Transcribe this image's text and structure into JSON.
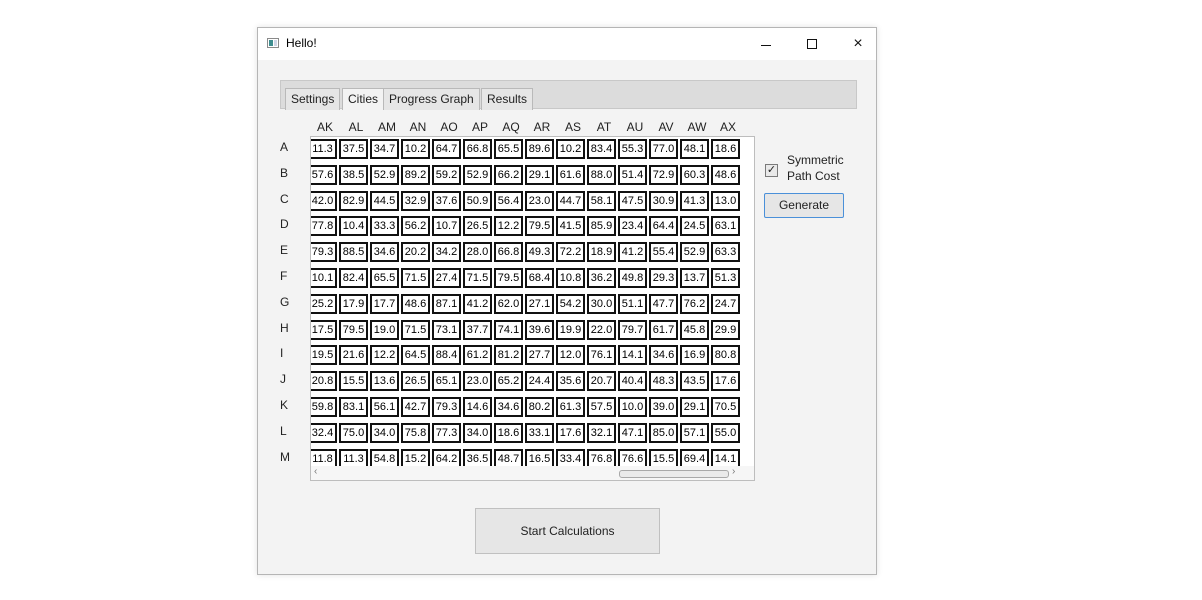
{
  "window": {
    "title": "Hello!",
    "controls": {
      "minimize": "minimize",
      "maximize": "maximize",
      "close": "×"
    }
  },
  "tabs": [
    {
      "label": "Settings",
      "active": false
    },
    {
      "label": "Cities",
      "active": true
    },
    {
      "label": "Progress Graph",
      "active": false
    },
    {
      "label": "Results",
      "active": false
    }
  ],
  "matrix": {
    "columns": [
      "AK",
      "AL",
      "AM",
      "AN",
      "AO",
      "AP",
      "AQ",
      "AR",
      "AS",
      "AT",
      "AU",
      "AV",
      "AW",
      "AX"
    ],
    "rows": [
      "A",
      "B",
      "C",
      "D",
      "E",
      "F",
      "G",
      "H",
      "I",
      "J",
      "K",
      "L",
      "M"
    ],
    "values": [
      [
        "11.3",
        "37.5",
        "34.7",
        "10.2",
        "64.7",
        "66.8",
        "65.5",
        "89.6",
        "10.2",
        "83.4",
        "55.3",
        "77.0",
        "48.1",
        "18.6"
      ],
      [
        "57.6",
        "38.5",
        "52.9",
        "89.2",
        "59.2",
        "52.9",
        "66.2",
        "29.1",
        "61.6",
        "88.0",
        "51.4",
        "72.9",
        "60.3",
        "48.6"
      ],
      [
        "42.0",
        "82.9",
        "44.5",
        "32.9",
        "37.6",
        "50.9",
        "56.4",
        "23.0",
        "44.7",
        "58.1",
        "47.5",
        "30.9",
        "41.3",
        "13.0"
      ],
      [
        "77.8",
        "10.4",
        "33.3",
        "56.2",
        "10.7",
        "26.5",
        "12.2",
        "79.5",
        "41.5",
        "85.9",
        "23.4",
        "64.4",
        "24.5",
        "63.1"
      ],
      [
        "79.3",
        "88.5",
        "34.6",
        "20.2",
        "34.2",
        "28.0",
        "66.8",
        "49.3",
        "72.2",
        "18.9",
        "41.2",
        "55.4",
        "52.9",
        "63.3"
      ],
      [
        "10.1",
        "82.4",
        "65.5",
        "71.5",
        "27.4",
        "71.5",
        "79.5",
        "68.4",
        "10.8",
        "36.2",
        "49.8",
        "29.3",
        "13.7",
        "51.3"
      ],
      [
        "25.2",
        "17.9",
        "17.7",
        "48.6",
        "87.1",
        "41.2",
        "62.0",
        "27.1",
        "54.2",
        "30.0",
        "51.1",
        "47.7",
        "76.2",
        "24.7"
      ],
      [
        "17.5",
        "79.5",
        "19.0",
        "71.5",
        "73.1",
        "37.7",
        "74.1",
        "39.6",
        "19.9",
        "22.0",
        "79.7",
        "61.7",
        "45.8",
        "29.9"
      ],
      [
        "19.5",
        "21.6",
        "12.2",
        "64.5",
        "88.4",
        "61.2",
        "81.2",
        "27.7",
        "12.0",
        "76.1",
        "14.1",
        "34.6",
        "16.9",
        "80.8"
      ],
      [
        "20.8",
        "15.5",
        "13.6",
        "26.5",
        "65.1",
        "23.0",
        "65.2",
        "24.4",
        "35.6",
        "20.7",
        "40.4",
        "48.3",
        "43.5",
        "17.6"
      ],
      [
        "59.8",
        "83.1",
        "56.1",
        "42.7",
        "79.3",
        "14.6",
        "34.6",
        "80.2",
        "61.3",
        "57.5",
        "10.0",
        "39.0",
        "29.1",
        "70.5"
      ],
      [
        "32.4",
        "75.0",
        "34.0",
        "75.8",
        "77.3",
        "34.0",
        "18.6",
        "33.1",
        "17.6",
        "32.1",
        "47.1",
        "85.0",
        "57.1",
        "55.0"
      ],
      [
        "11.8",
        "11.3",
        "54.8",
        "15.2",
        "64.2",
        "36.5",
        "48.7",
        "16.5",
        "33.4",
        "76.8",
        "76.6",
        "15.5",
        "69.4",
        "14.1"
      ]
    ]
  },
  "side": {
    "symmetric_label": "Symmetric Path Cost",
    "symmetric_checked": true,
    "generate_label": "Generate"
  },
  "start_label": "Start Calculations"
}
